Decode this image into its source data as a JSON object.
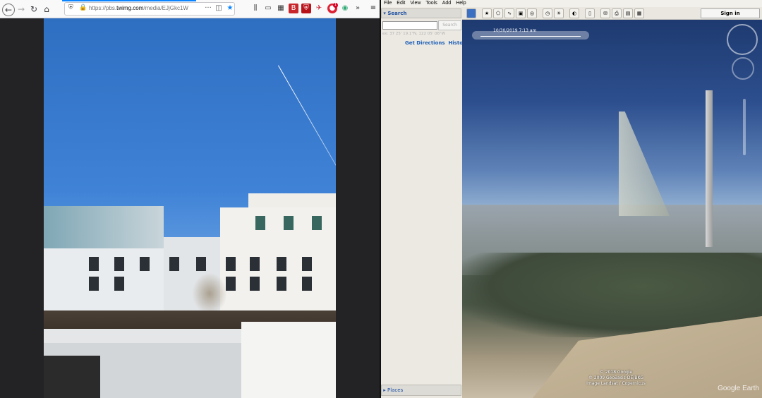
{
  "firefox": {
    "url_prefix": "https://pbs.",
    "url_domain": "twimg.com",
    "url_path": "/media/EJjGkc1W",
    "icons": [
      "back-icon",
      "forward-icon",
      "reload-icon",
      "home-icon",
      "shield-icon",
      "lock-icon",
      "more-icon",
      "pocket-icon",
      "star-icon",
      "library-icon",
      "sidebar-icon",
      "extensions-icon"
    ],
    "badge_count": "1",
    "accent": "#0a84ff"
  },
  "google_earth": {
    "menu": [
      "File",
      "Edit",
      "View",
      "Tools",
      "Add",
      "Help"
    ],
    "search_header": "Search",
    "search_button": "Search",
    "coord_hint": "ex: 37 25' 19.1\"N, 122 05' 06\"W",
    "get_directions": "Get Directions",
    "history": "History",
    "places_header": "Places",
    "sign_in": "Sign in",
    "timestamp": "10/30/2019   7:13 am",
    "copyright": [
      "© 2018 Google",
      "© 2009 GeoBasis-DE/BKG",
      "Image Landsat / Copernicus"
    ],
    "brand": "Google Earth"
  }
}
